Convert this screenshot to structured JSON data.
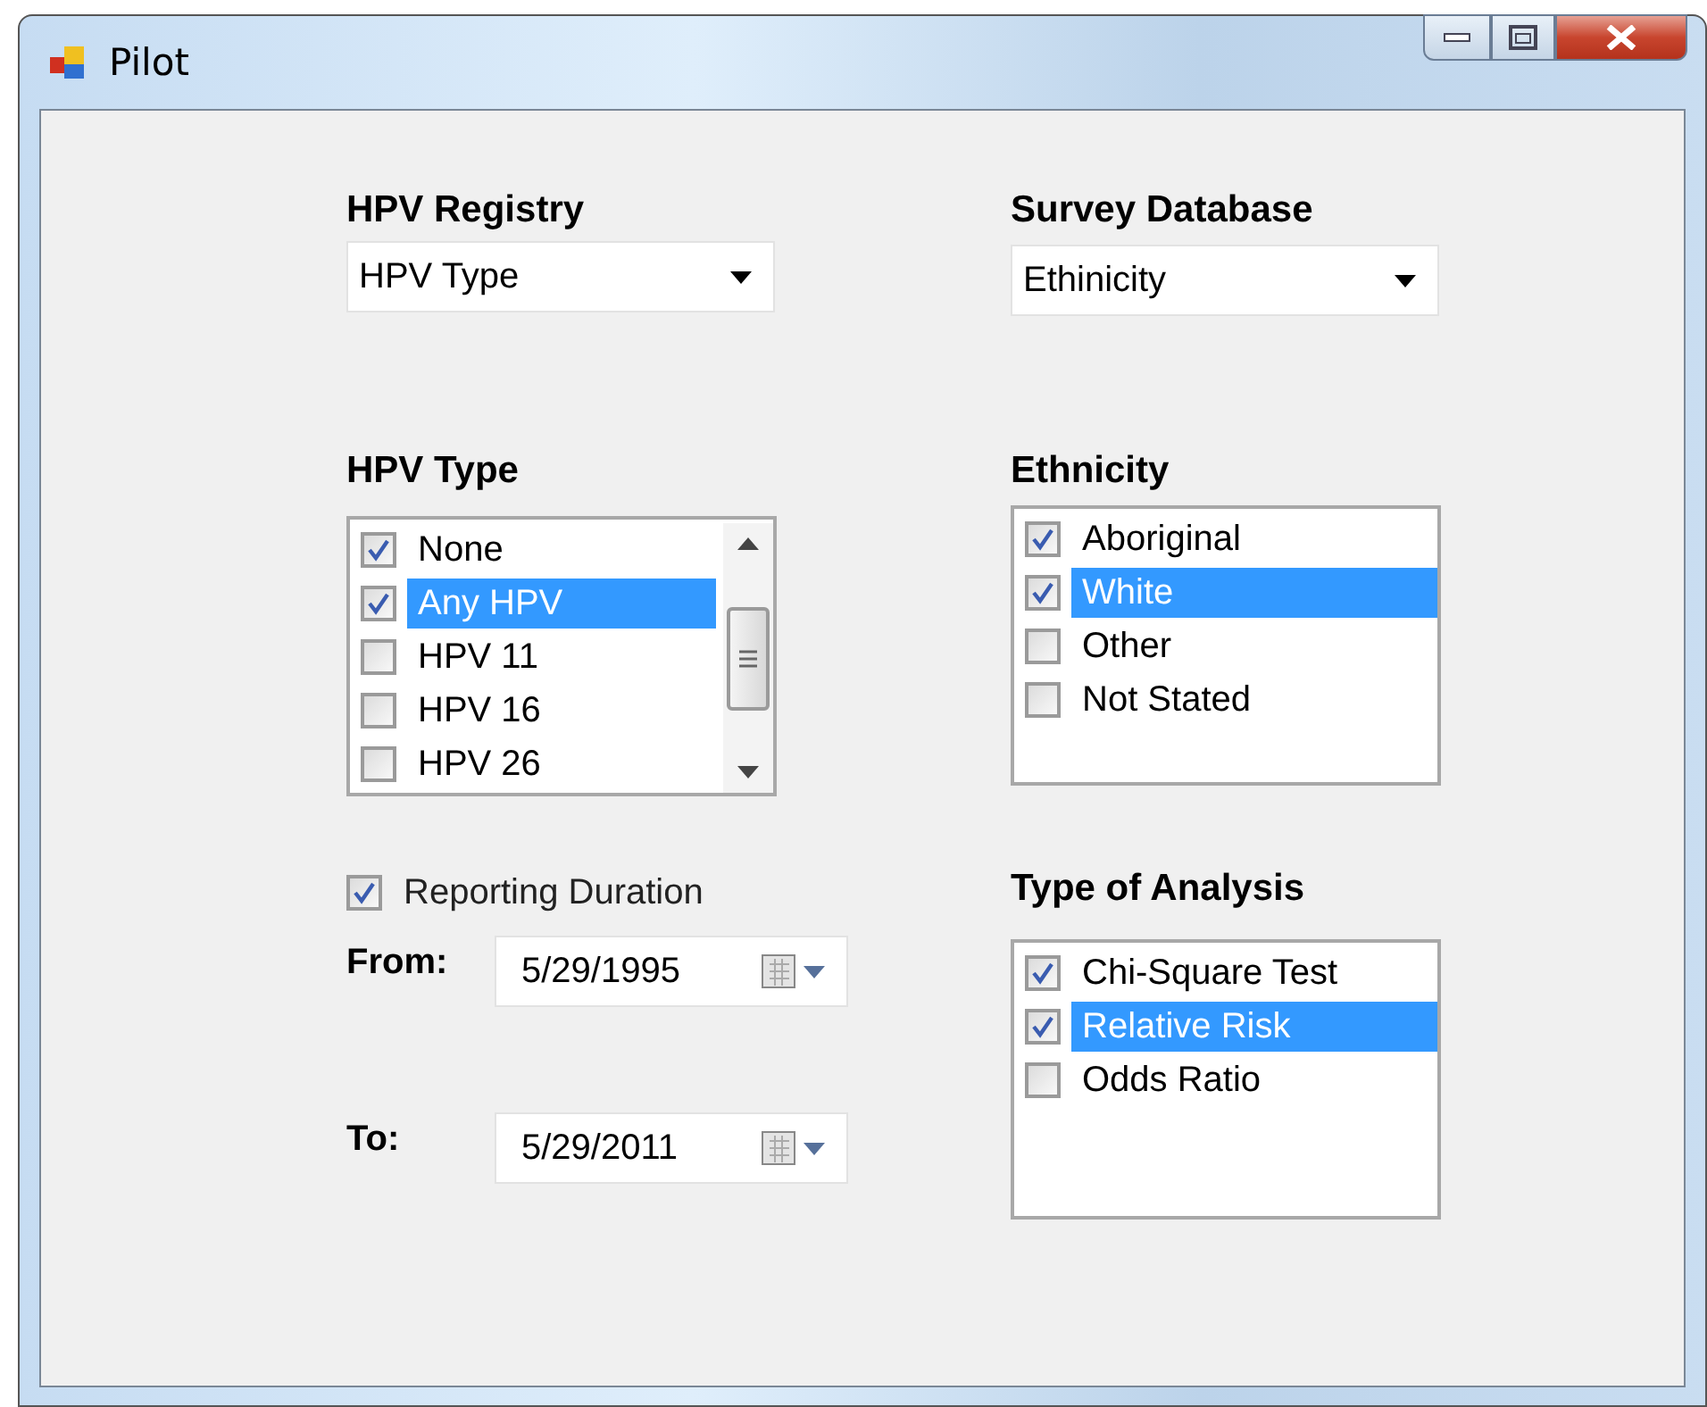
{
  "window": {
    "title": "Pilot"
  },
  "hpv_registry": {
    "label": "HPV Registry",
    "value": "HPV Type"
  },
  "survey_database": {
    "label": "Survey Database",
    "value": "Ethinicity"
  },
  "hpv_type": {
    "label": "HPV Type",
    "items": [
      {
        "label": "None",
        "checked": true,
        "selected": false
      },
      {
        "label": "Any HPV",
        "checked": true,
        "selected": true
      },
      {
        "label": "HPV 11",
        "checked": false,
        "selected": false
      },
      {
        "label": "HPV 16",
        "checked": false,
        "selected": false
      },
      {
        "label": "HPV 26",
        "checked": false,
        "selected": false
      }
    ]
  },
  "ethnicity": {
    "label": "Ethnicity",
    "items": [
      {
        "label": "Aboriginal",
        "checked": true,
        "selected": false
      },
      {
        "label": "White",
        "checked": true,
        "selected": true
      },
      {
        "label": "Other",
        "checked": false,
        "selected": false
      },
      {
        "label": "Not Stated",
        "checked": false,
        "selected": false
      }
    ]
  },
  "reporting_duration": {
    "label": "Reporting Duration",
    "checked": true,
    "from": {
      "label": "From:",
      "value": "5/29/1995"
    },
    "to": {
      "label": "To:",
      "value": "5/29/2011"
    }
  },
  "type_of_analysis": {
    "label": "Type of Analysis",
    "items": [
      {
        "label": "Chi-Square Test",
        "checked": true,
        "selected": false
      },
      {
        "label": "Relative Risk",
        "checked": true,
        "selected": true
      },
      {
        "label": "Odds Ratio",
        "checked": false,
        "selected": false
      }
    ]
  }
}
